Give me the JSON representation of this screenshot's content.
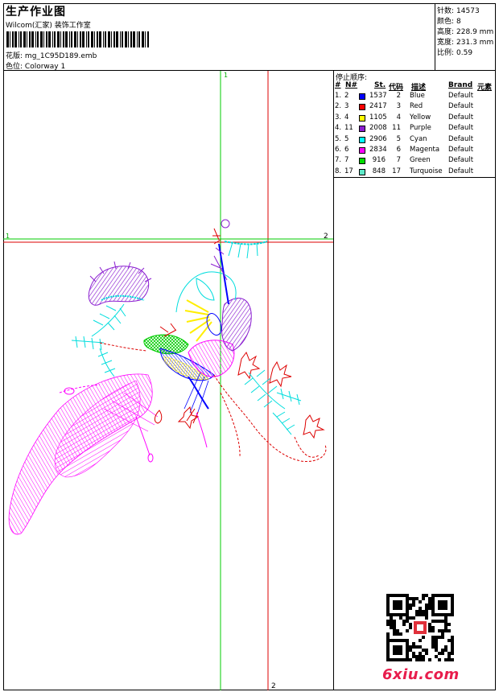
{
  "header": {
    "title": "生产作业图",
    "subtitle": "Wilcom(汇家) 装饰工作室",
    "design_label": "花版:",
    "design_file": "mg_1C95D189.emb",
    "colorway_label": "色位:",
    "colorway": "Colorway 1"
  },
  "stats": [
    {
      "label": "针数:",
      "value": "14573"
    },
    {
      "label": "颜色:",
      "value": "8"
    },
    {
      "label": "高度:",
      "value": "228.9 mm"
    },
    {
      "label": "宽度:",
      "value": "231.3 mm"
    },
    {
      "label": "比例:",
      "value": "0.59"
    }
  ],
  "guides": {
    "v1": "1",
    "v2": "2",
    "h1": "1",
    "h2": "2"
  },
  "stop_sequence": {
    "title": "停止顺序:",
    "headers": {
      "index": "#",
      "no": "N#",
      "st": "St.",
      "code": "代码",
      "desc": "描述",
      "brand": "Brand",
      "element": "元素"
    },
    "rows": [
      {
        "index": "1.",
        "no": "2",
        "color": "#0000ff",
        "st": "1537",
        "code": "2",
        "desc": "Blue",
        "brand": "Default"
      },
      {
        "index": "2.",
        "no": "3",
        "color": "#ff0000",
        "st": "2417",
        "code": "3",
        "desc": "Red",
        "brand": "Default"
      },
      {
        "index": "3.",
        "no": "4",
        "color": "#ffff00",
        "st": "1105",
        "code": "4",
        "desc": "Yellow",
        "brand": "Default"
      },
      {
        "index": "4.",
        "no": "11",
        "color": "#8b1fd1",
        "st": "2008",
        "code": "11",
        "desc": "Purple",
        "brand": "Default"
      },
      {
        "index": "5.",
        "no": "5",
        "color": "#00ffff",
        "st": "2906",
        "code": "5",
        "desc": "Cyan",
        "brand": "Default"
      },
      {
        "index": "6.",
        "no": "6",
        "color": "#ff00ff",
        "st": "2834",
        "code": "6",
        "desc": "Magenta",
        "brand": "Default"
      },
      {
        "index": "7.",
        "no": "7",
        "color": "#00dd00",
        "st": "916",
        "code": "7",
        "desc": "Green",
        "brand": "Default"
      },
      {
        "index": "8.",
        "no": "17",
        "color": "#5ee8c8",
        "st": "848",
        "code": "17",
        "desc": "Turquoise",
        "brand": "Default"
      }
    ]
  },
  "watermark": {
    "logo_text": "6xiu.com"
  }
}
